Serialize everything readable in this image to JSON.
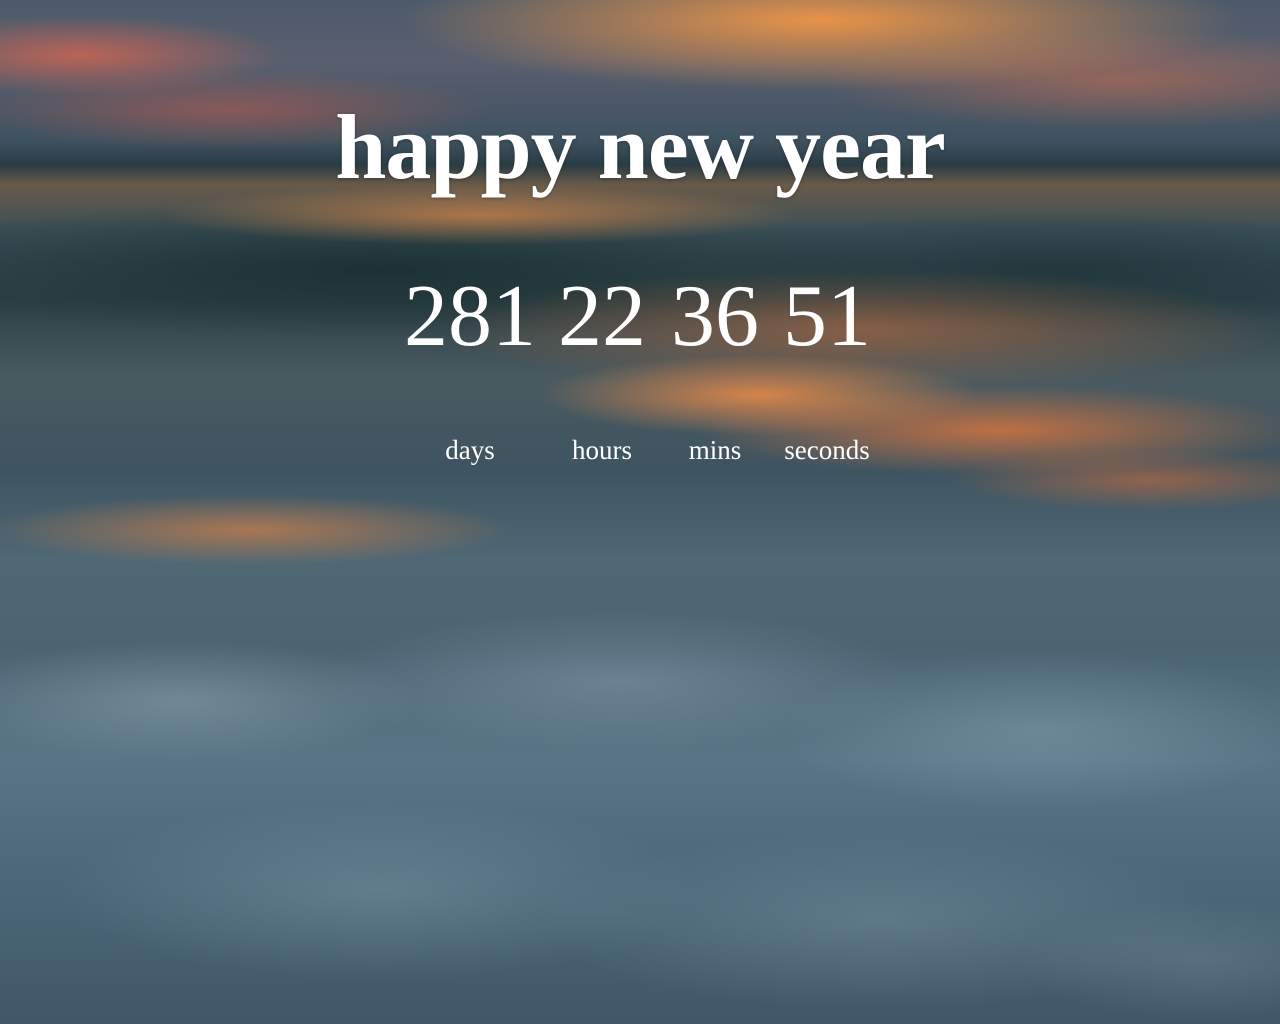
{
  "page": {
    "title": "happy new year"
  },
  "countdown": {
    "days": {
      "value": "281",
      "label": "days"
    },
    "hours": {
      "value": "22",
      "label": "hours"
    },
    "mins": {
      "value": "36",
      "label": "mins"
    },
    "seconds": {
      "value": "51",
      "label": "seconds"
    }
  },
  "colors": {
    "text": "#ffffff",
    "sunset_accent": "#f08c46",
    "sea_dark": "#2a3c44"
  }
}
